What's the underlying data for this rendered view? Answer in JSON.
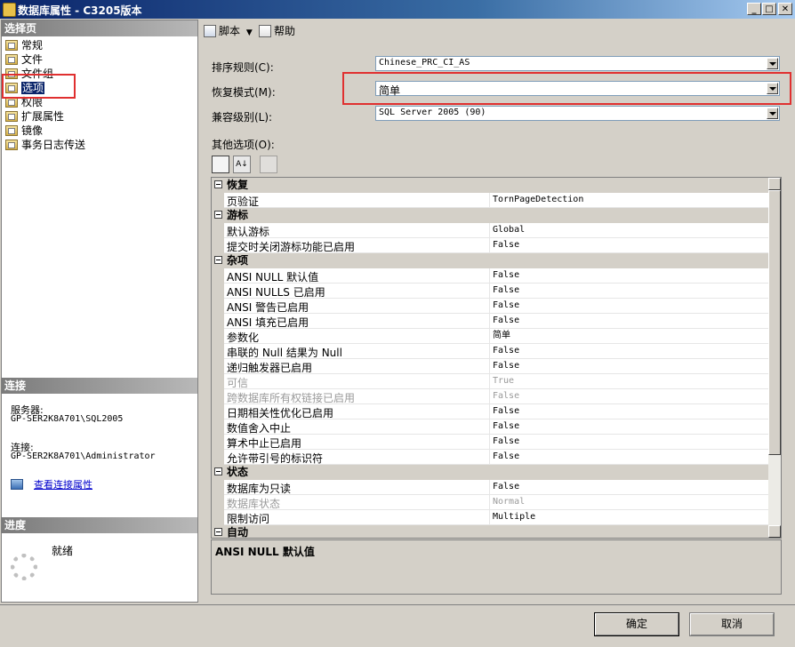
{
  "window": {
    "title": "数据库属性 - C3205版本"
  },
  "left": {
    "select_page_header": "选择页",
    "items": [
      "常规",
      "文件",
      "文件组",
      "选项",
      "权限",
      "扩展属性",
      "镜像",
      "事务日志传送"
    ],
    "selected_index": 3,
    "connection_header": "连接",
    "server_label": "服务器:",
    "server_value": "GP-SER2K8A701\\SQL2005",
    "connection_label": "连接:",
    "connection_value": "GP-SER2K8A701\\Administrator",
    "view_connection_link": "查看连接属性",
    "progress_header": "进度",
    "progress_status": "就绪"
  },
  "toolbar": {
    "script_label": "脚本",
    "help_label": "帮助"
  },
  "form": {
    "collation_label": "排序规则(C):",
    "collation_value": "Chinese_PRC_CI_AS",
    "recovery_label": "恢复模式(M):",
    "recovery_value": "简单",
    "compat_label": "兼容级别(L):",
    "compat_value": "SQL Server 2005 (90)",
    "other_label": "其他选项(O):"
  },
  "grid": {
    "rows": [
      {
        "type": "cat",
        "name": "恢复"
      },
      {
        "type": "row",
        "name": "页验证",
        "value": "TornPageDetection"
      },
      {
        "type": "cat",
        "name": "游标"
      },
      {
        "type": "row",
        "name": "默认游标",
        "value": "Global"
      },
      {
        "type": "row",
        "name": "提交时关闭游标功能已启用",
        "value": "False"
      },
      {
        "type": "cat",
        "name": "杂项"
      },
      {
        "type": "row",
        "name": "ANSI NULL 默认值",
        "value": "False"
      },
      {
        "type": "row",
        "name": "ANSI NULLS 已启用",
        "value": "False"
      },
      {
        "type": "row",
        "name": "ANSI 警告已启用",
        "value": "False"
      },
      {
        "type": "row",
        "name": "ANSI 填充已启用",
        "value": "False"
      },
      {
        "type": "row",
        "name": "参数化",
        "value": "简单"
      },
      {
        "type": "row",
        "name": "串联的 Null 结果为 Null",
        "value": "False"
      },
      {
        "type": "row",
        "name": "递归触发器已启用",
        "value": "False"
      },
      {
        "type": "row",
        "name": "可信",
        "value": "True",
        "disabled": true
      },
      {
        "type": "row",
        "name": "跨数据库所有权链接已启用",
        "value": "False",
        "disabled": true
      },
      {
        "type": "row",
        "name": "日期相关性优化已启用",
        "value": "False"
      },
      {
        "type": "row",
        "name": "数值舍入中止",
        "value": "False"
      },
      {
        "type": "row",
        "name": "算术中止已启用",
        "value": "False"
      },
      {
        "type": "row",
        "name": "允许带引号的标识符",
        "value": "False"
      },
      {
        "type": "cat",
        "name": "状态"
      },
      {
        "type": "row",
        "name": "数据库为只读",
        "value": "False"
      },
      {
        "type": "row",
        "name": "数据库状态",
        "value": "Normal",
        "disabled": true
      },
      {
        "type": "row",
        "name": "限制访问",
        "value": "Multiple"
      },
      {
        "type": "cat",
        "name": "自动"
      }
    ]
  },
  "description": {
    "title": "ANSI NULL 默认值"
  },
  "buttons": {
    "ok": "确定",
    "cancel": "取消"
  }
}
